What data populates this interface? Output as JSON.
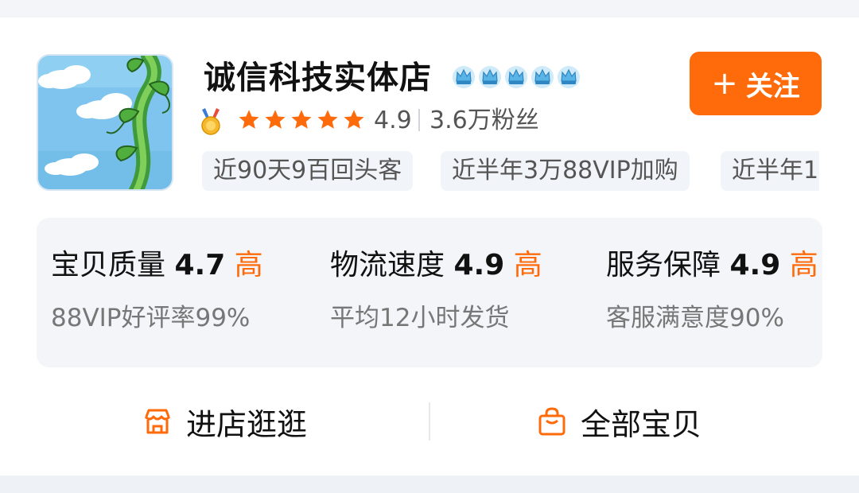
{
  "shop": {
    "name": "诚信科技实体店",
    "crown_count": 5,
    "crown_icon": "crown-icon",
    "medal_icon": "medal-icon",
    "rating": "4.9",
    "star_count": 5,
    "fans": "3.6万粉丝"
  },
  "follow_button": {
    "plus": "+",
    "label": "关注"
  },
  "tags": [
    "近90天9百回头客",
    "近半年3万88VIP加购",
    "近半年1"
  ],
  "scores": [
    {
      "title": "宝贝质量",
      "value": "4.7",
      "level": "高",
      "sub": "88VIP好评率99%"
    },
    {
      "title": "物流速度",
      "value": "4.9",
      "level": "高",
      "sub": "平均12小时发货"
    },
    {
      "title": "服务保障",
      "value": "4.9",
      "level": "高",
      "sub": "客服满意度90%"
    }
  ],
  "actions": {
    "enter_store": {
      "label": "进店逛逛",
      "icon": "store-icon"
    },
    "all_items": {
      "label": "全部宝贝",
      "icon": "shopping-bag-icon"
    }
  },
  "colors": {
    "accent": "#ff6a0a",
    "star": "#ff6a0a",
    "crown": "#5ab4e6",
    "tag_bg": "#f1f4f8",
    "panel_bg": "#f3f5f8"
  }
}
